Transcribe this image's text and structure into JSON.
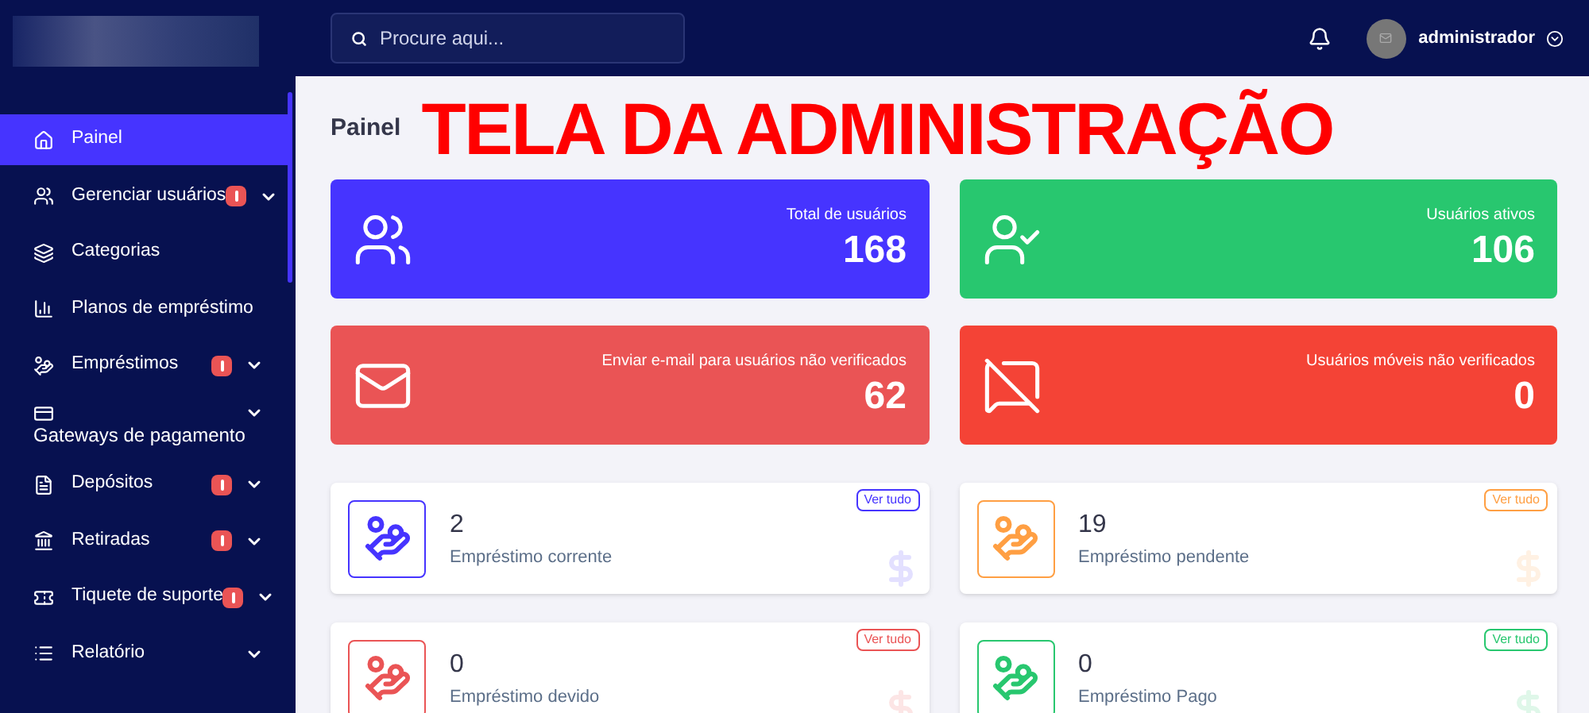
{
  "sidebar": {
    "items": [
      {
        "label": "Painel",
        "selected": true,
        "alert": false,
        "expandable": false,
        "kind": "inline"
      },
      {
        "label": "Gerenciar usuários",
        "selected": false,
        "alert": true,
        "expandable": true,
        "kind": "inline"
      },
      {
        "label": "Categorias",
        "selected": false,
        "alert": false,
        "expandable": false,
        "kind": "inline"
      },
      {
        "label": "Planos de empréstimo",
        "selected": false,
        "alert": false,
        "expandable": false,
        "kind": "inline"
      },
      {
        "label": "Empréstimos",
        "selected": false,
        "alert": true,
        "expandable": true,
        "kind": "inline"
      },
      {
        "label": "Gateways de pagamento",
        "selected": false,
        "alert": false,
        "expandable": true,
        "kind": "stacked"
      },
      {
        "label": "Depósitos",
        "selected": false,
        "alert": true,
        "expandable": true,
        "kind": "inline"
      },
      {
        "label": "Retiradas",
        "selected": false,
        "alert": true,
        "expandable": true,
        "kind": "inline"
      },
      {
        "label": "Tiquete de suporte",
        "selected": false,
        "alert": true,
        "expandable": true,
        "kind": "inline"
      },
      {
        "label": "Relatório",
        "selected": false,
        "alert": false,
        "expandable": true,
        "kind": "inline"
      }
    ]
  },
  "topbar": {
    "search": {
      "placeholder": "Procure aqui..."
    },
    "user": {
      "name": "administrador"
    }
  },
  "page": {
    "title": "Painel",
    "overlay_caption": "TELA DA ADMINISTRAÇÃO"
  },
  "stat_cards": [
    {
      "label": "Total de usuários",
      "value": "168",
      "color": "#4634ff",
      "kind": "users"
    },
    {
      "label": "Usuários ativos",
      "value": "106",
      "color": "#28c76f",
      "kind": "user-check"
    },
    {
      "label": "Enviar e-mail para usuários não verificados",
      "value": "62",
      "color": "#ea5455",
      "kind": "mail"
    },
    {
      "label": "Usuários móveis não verificados",
      "value": "0",
      "color": "#f44336",
      "kind": "message-off"
    }
  ],
  "loan_cards": [
    {
      "value": "2",
      "label": "Empréstimo corrente",
      "link": "Ver tudo",
      "color": "#4634ff"
    },
    {
      "value": "19",
      "label": "Empréstimo pendente",
      "link": "Ver tudo",
      "color": "#ff9f43"
    },
    {
      "value": "0",
      "label": "Empréstimo devido",
      "link": "Ver tudo",
      "color": "#ea5455"
    },
    {
      "value": "0",
      "label": "Empréstimo Pago",
      "link": "Ver tudo",
      "color": "#28c76f"
    }
  ]
}
